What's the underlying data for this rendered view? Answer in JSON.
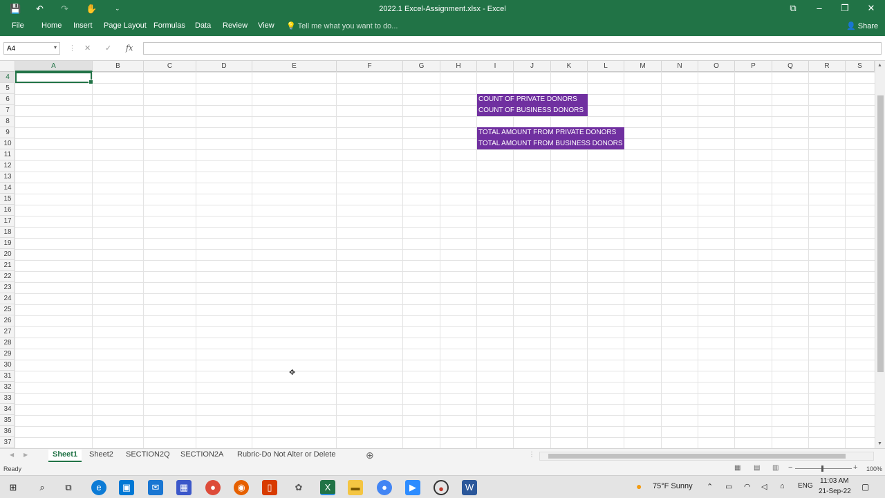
{
  "window": {
    "title": "2022.1 Excel-Assignment.xlsx - Excel",
    "minimize": "–",
    "restore": "❐",
    "close": "✕",
    "ribbon_display": "⧉"
  },
  "qat": {
    "save": "💾",
    "undo": "↶",
    "redo": "↷",
    "touch": "✋",
    "customize": "⌄"
  },
  "ribbon": {
    "tabs": [
      "File",
      "Home",
      "Insert",
      "Page Layout",
      "Formulas",
      "Data",
      "Review",
      "View"
    ],
    "tell_me": "Tell me what you want to do...",
    "share": "Share"
  },
  "formula_bar": {
    "name_box": "A4",
    "cancel": "✕",
    "enter": "✓",
    "fx": "fx",
    "value": ""
  },
  "grid": {
    "columns": [
      "A",
      "B",
      "C",
      "D",
      "E",
      "F",
      "G",
      "H",
      "I",
      "J",
      "K",
      "L",
      "M",
      "N",
      "O",
      "P",
      "Q",
      "R",
      "S"
    ],
    "rows": [
      "4",
      "5",
      "6",
      "7",
      "8",
      "9",
      "10",
      "11",
      "12",
      "13",
      "14",
      "15",
      "16",
      "17",
      "18",
      "19",
      "20",
      "21",
      "22",
      "23",
      "24",
      "25",
      "26",
      "27",
      "28",
      "29",
      "30",
      "31",
      "32",
      "33",
      "34",
      "35",
      "36",
      "37"
    ],
    "selected_cell": "A4",
    "cell_I6": "COUNT OF PRIVATE DONORS",
    "cell_I7": "COUNT OF BUSINESS DONORS",
    "cell_I9": "TOTAL AMOUNT FROM PRIVATE DONORS",
    "cell_I10": "TOTAL AMOUNT FROM BUSINESS DONORS",
    "highlight_color": "#7030a0"
  },
  "sheets": {
    "tabs": [
      "Sheet1",
      "Sheet2",
      "SECTION2Q",
      "SECTION2A",
      "Rubric-Do Not Alter or Delete"
    ],
    "active": "Sheet1",
    "add": "⊕"
  },
  "status": {
    "text": "Ready",
    "zoom": "100%"
  },
  "taskbar": {
    "weather": "75°F  Sunny",
    "lang": "ENG",
    "time": "11:03 AM",
    "date": "21-Sep-22"
  },
  "colors": {
    "accent": "#217346"
  }
}
